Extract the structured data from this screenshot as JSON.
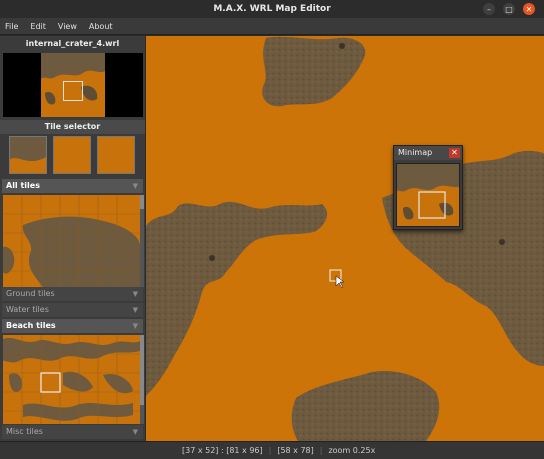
{
  "window": {
    "title": "M.A.X. WRL Map Editor"
  },
  "menu": {
    "items": [
      "File",
      "Edit",
      "View",
      "About"
    ]
  },
  "sidebar": {
    "filename": "internal_crater_4.wrl",
    "tile_selector_label": "Tile selector",
    "categories": {
      "all": "All tiles",
      "ground": "Ground tiles",
      "water": "Water tiles",
      "beach": "Beach tiles",
      "misc": "Misc tiles"
    }
  },
  "minimap": {
    "title": "Minimap",
    "close": "✕"
  },
  "status": {
    "coords": "[37 x 52] : [81 x 96]",
    "size": "[58 x 78]",
    "zoom": "zoom 0.25x"
  },
  "colors": {
    "sand": "#cd7408",
    "rock": "#6e5a3e",
    "accent_close": "#e95420"
  }
}
